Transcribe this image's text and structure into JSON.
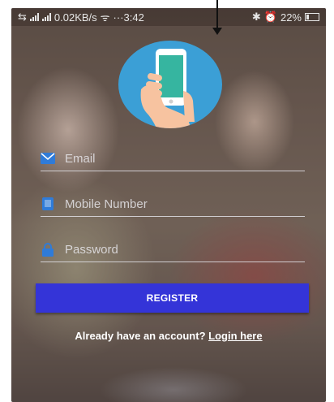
{
  "status_bar": {
    "network_speed": "0.02KB/s",
    "time": "···3:42",
    "battery": "22%"
  },
  "form": {
    "email_placeholder": "Email",
    "mobile_placeholder": "Mobile Number",
    "password_placeholder": "Password",
    "register_label": "REGISTER"
  },
  "footer": {
    "prompt": "Already have an account?",
    "login_link": "Login here"
  },
  "colors": {
    "register_button": "#3434d8",
    "logo_circle": "#3b9fd6",
    "field_icon": "#2f7bd8"
  },
  "icons": {
    "logo": "phone-in-hand-icon",
    "email": "envelope-icon",
    "mobile": "phone-icon",
    "password": "lock-icon"
  }
}
